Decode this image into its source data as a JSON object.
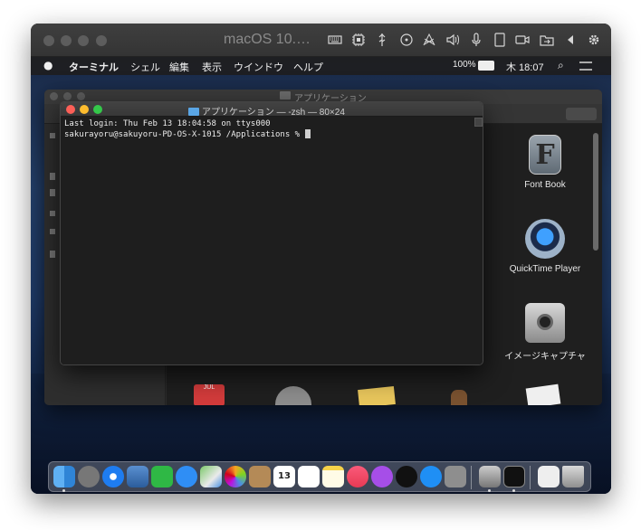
{
  "vm": {
    "title": "macOS 10.…"
  },
  "menubar": {
    "apple_icon": "apple-icon",
    "app_name": "ターミナル",
    "items": [
      "シェル",
      "編集",
      "表示",
      "ウインドウ",
      "ヘルプ"
    ],
    "battery": "100%",
    "clock": "木 18:07"
  },
  "finder": {
    "title": "アプリケーション",
    "apps": [
      {
        "label": "Font Book",
        "icon": "font-book-icon"
      },
      {
        "label": "QuickTime Player",
        "icon": "quicktime-icon"
      },
      {
        "label": "イメージキャプチャ",
        "icon": "image-capture-icon"
      }
    ]
  },
  "terminal": {
    "title": "アプリケーション — -zsh — 80×24",
    "lines": [
      "Last login: Thu Feb 13 18:04:58 on ttys000",
      "sakurayoru@sakuyoru-PD-OS-X-1015 /Applications % "
    ]
  },
  "dock": {
    "calendar_day": "13",
    "calendar_month": "JUL",
    "apps": [
      "finder-icon",
      "launchpad-icon",
      "safari-icon",
      "preview-icon",
      "facetime-icon",
      "messages-icon",
      "maps-icon",
      "photos-icon",
      "contacts-icon",
      "calendar-icon",
      "reminders-icon",
      "notes-icon",
      "music-icon",
      "podcasts-icon",
      "tv-icon",
      "app-store-icon",
      "system-preferences-icon",
      "image-capture-dock-icon",
      "terminal-dock-icon",
      "documents-icon",
      "trash-icon"
    ]
  },
  "colors": {
    "close": "#fc5f57",
    "minimize": "#fdbc2e",
    "zoom": "#34c84a"
  }
}
